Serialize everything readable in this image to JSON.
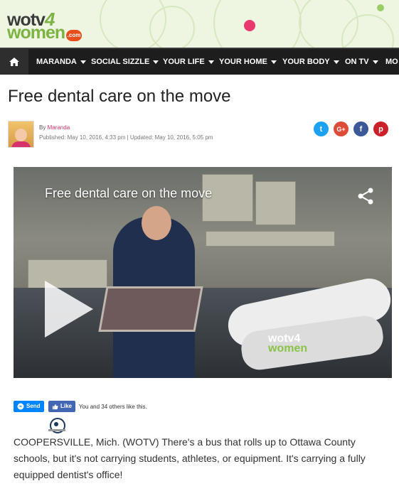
{
  "header": {
    "logo_part1": "wotv",
    "logo_four": "4",
    "logo_part2": "women",
    "logo_com": ".com"
  },
  "nav": {
    "home_icon": "home-icon",
    "items": [
      "MARANDA",
      "SOCIAL SIZZLE",
      "YOUR LIFE",
      "YOUR HOME",
      "YOUR BODY",
      "ON TV",
      "MO"
    ]
  },
  "article": {
    "title": "Free dental care on the move",
    "by_prefix": "By",
    "author": "Maranda",
    "dates": "Published: May 10, 2016, 4:33 pm  |  Updated: May 10, 2016, 5:05 pm",
    "share_icons": [
      "twitter-icon",
      "google-plus-icon",
      "facebook-icon",
      "pinterest-icon"
    ],
    "share_glyphs": [
      "t",
      "G+",
      "f",
      "p"
    ],
    "share_colors": [
      "#1da1f2",
      "#dd4b39",
      "#3b5998",
      "#cb2027"
    ]
  },
  "video": {
    "title": "Free dental care on the move",
    "watermark_top": "wotv4",
    "watermark_bottom": "women"
  },
  "social": {
    "send_label": "Send",
    "like_label": "Like",
    "likes_text": "You and 34 others like this."
  },
  "body_text": "COOPERSVILLE, Mich. (WOTV) There's a bus that rolls up to Ottawa County schools, but it's not carrying students, athletes, or equipment. It's carrying a fully equipped dentist's office!"
}
